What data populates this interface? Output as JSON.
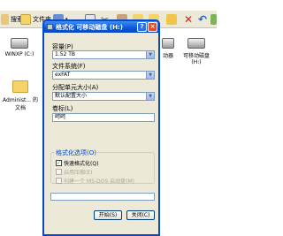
{
  "toolbar": {
    "search_label": "搜索",
    "folders_label": "文件夹",
    "view_icon": "view-icon",
    "undo_icon": "undo-icon",
    "delete_icon": "delete-icon"
  },
  "explorer": {
    "drive_c_label": "WINXP (C:)",
    "drive_d_label": "D:",
    "removable_1_label": "动器",
    "removable_2_label": "可移动磁盘 (H:)",
    "user_docs_label": "Administ... 的文档"
  },
  "dialog": {
    "title": "格式化 可移动磁盘 (H:)",
    "help": "?",
    "close": "×",
    "capacity_label": "容量(P)",
    "capacity_value": "1.52 TB",
    "filesystem_label": "文件系统(F)",
    "filesystem_value": "exFAT",
    "allocation_label": "分配单元大小(A)",
    "allocation_value": "默认配置大小",
    "volume_label": "卷标(L)",
    "volume_value": "呵呵",
    "format_options_label": "格式化选项(O)",
    "quick_format_label": "快速格式化(Q)",
    "compression_label": "启用压缩(E)",
    "msdos_label": "创建一个 MS-DOS 启动盘(M)",
    "start_button": "开始(S)",
    "close_button": "关闭(C)",
    "quick_format_checked": true,
    "progress_percent": 0
  },
  "colors": {
    "titlebar": "#0a58d8",
    "dialog_bg": "#ece9d8",
    "group_title": "#0046d5",
    "close_red": "#d9522c"
  }
}
